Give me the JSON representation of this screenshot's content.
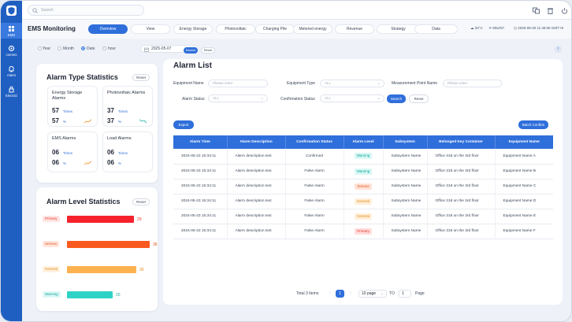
{
  "search": {
    "placeholder": "Search"
  },
  "sidebar": {
    "items": [
      {
        "label": "EMS",
        "icon": "grid-icon"
      },
      {
        "label": "comms",
        "icon": "gear-icon"
      },
      {
        "label": "Alarm",
        "icon": "bell-icon"
      },
      {
        "label": "Electrici",
        "icon": "lock-icon"
      }
    ]
  },
  "header": {
    "title": "EMS Monitoring",
    "tabs": [
      "Overview",
      "View",
      "Energy Storage",
      "Photovoltaic",
      "Charging Pile",
      "Metered energy",
      "Revenue",
      "Strategy",
      "Data"
    ],
    "active_tab": "Overview",
    "temperature": "26°C",
    "irradiance": "80w/m²",
    "datetime": "2025-08-30 11:48:06 GMT+8"
  },
  "filter": {
    "options": [
      "Year",
      "Month",
      "Date",
      "hour"
    ],
    "selected": "Date",
    "date": "2025-05-07",
    "search_label": "Search",
    "reset_label": "Reset"
  },
  "alarm_type": {
    "title": "Alarm Type Statistics",
    "reset": "Reset",
    "cards": [
      {
        "title": "Energy Storage Alarms",
        "times": "57",
        "times_unit": "Times",
        "pct": "57",
        "pct_unit": "%",
        "trend": "up"
      },
      {
        "title": "Photovoltaic Alarms",
        "times": "37",
        "times_unit": "Times",
        "pct": "37",
        "pct_unit": "%",
        "trend": "down"
      },
      {
        "title": "EMS Alarms",
        "times": "06",
        "times_unit": "Times",
        "pct": "06",
        "pct_unit": "%",
        "trend": "up"
      },
      {
        "title": "Load Alarms",
        "times": "06",
        "times_unit": "Times",
        "pct": "06",
        "pct_unit": "%",
        "trend": "none"
      }
    ]
  },
  "alarm_level": {
    "title": "Alarm Level Statistics",
    "reset": "Reset",
    "levels": [
      {
        "label": "Primary",
        "value": 29,
        "max": 36,
        "color": "#f5222d",
        "tag_bg": "#ffe5e3",
        "tag_fg": "#e8362a"
      },
      {
        "label": "Serious",
        "value": 36,
        "max": 36,
        "color": "#fa5a1f",
        "tag_bg": "#ffe6dc",
        "tag_fg": "#e2541f"
      },
      {
        "label": "General",
        "value": 30,
        "max": 36,
        "color": "#fdb24f",
        "tag_bg": "#fff1df",
        "tag_fg": "#e38a17"
      },
      {
        "label": "Warning",
        "value": 20,
        "max": 36,
        "color": "#2fd3c6",
        "tag_bg": "#dcf8f6",
        "tag_fg": "#13a79b"
      }
    ]
  },
  "alarm_list": {
    "title": "Alarm List",
    "filters": {
      "equipment_name": "Equipment Name",
      "equipment_name_ph": "Please enter",
      "equipment_type": "Equipment Type",
      "equipment_type_val": "ALL",
      "measurement_point": "Measurement Point Name",
      "measurement_point_ph": "Please enter",
      "alarm_status": "Alarm Status",
      "alarm_status_val": "ALL",
      "confirmation_status": "Confirmation Status",
      "confirmation_status_val": "ALL",
      "search": "Search",
      "reset": "Reset"
    },
    "export": "Export",
    "batch_confirm": "Batch Confirm",
    "columns": [
      "Alarm Time",
      "Alarm Description",
      "Confirmation Status",
      "Alarm Level",
      "Subsystem",
      "Belonged Key Container",
      "Equipment Name"
    ],
    "rows": [
      {
        "time": "2024-05-23 15:34:11",
        "desc": "Alarm description text",
        "status": "Confirmed",
        "level": "Warning",
        "subsystem": "Subsystem Name",
        "container": "Office 318 on the 3rd floor",
        "equipment": "Equipment Name A"
      },
      {
        "time": "2024-05-23 15:34:11",
        "desc": "Alarm description text",
        "status": "False Alarm",
        "level": "Warning",
        "subsystem": "Subsystem Name",
        "container": "Office 318 on the 3rd floor",
        "equipment": "Equipment Name B"
      },
      {
        "time": "2024-05-23 15:34:11",
        "desc": "Alarm description text",
        "status": "False Alarm",
        "level": "Serious",
        "subsystem": "Subsystem Name",
        "container": "Office 318 on the 3rd floor",
        "equipment": "Equipment Name C"
      },
      {
        "time": "2024-05-23 15:34:11",
        "desc": "Alarm description text",
        "status": "False Alarm",
        "level": "General",
        "subsystem": "Subsystem Name",
        "container": "Office 318 on the 3rd floor",
        "equipment": "Equipment Name D"
      },
      {
        "time": "2024-05-23 15:34:11",
        "desc": "Alarm description text",
        "status": "False Alarm",
        "level": "General",
        "subsystem": "Subsystem Name",
        "container": "Office 318 on the 3rd floor",
        "equipment": "Equipment Name E"
      },
      {
        "time": "2024-05-23 15:34:11",
        "desc": "Alarm description text",
        "status": "False Alarm",
        "level": "Primary",
        "subsystem": "Subsystem Name",
        "container": "Office 318 on the 3rd floor",
        "equipment": "Equipment Name F"
      }
    ],
    "pagination": {
      "total": "Total 3 Items",
      "current": "1",
      "page_size": "10 page",
      "goto_label": "TO",
      "goto_value": "1",
      "page_label": "Page"
    }
  },
  "level_colors": {
    "Warning": {
      "bg": "#d8f7f4",
      "fg": "#13a79b"
    },
    "Serious": {
      "bg": "#ffe2d6",
      "fg": "#e2541f"
    },
    "General": {
      "bg": "#ffefd9",
      "fg": "#e38a17"
    },
    "Primary": {
      "bg": "#ffdcdc",
      "fg": "#e8362a"
    }
  }
}
